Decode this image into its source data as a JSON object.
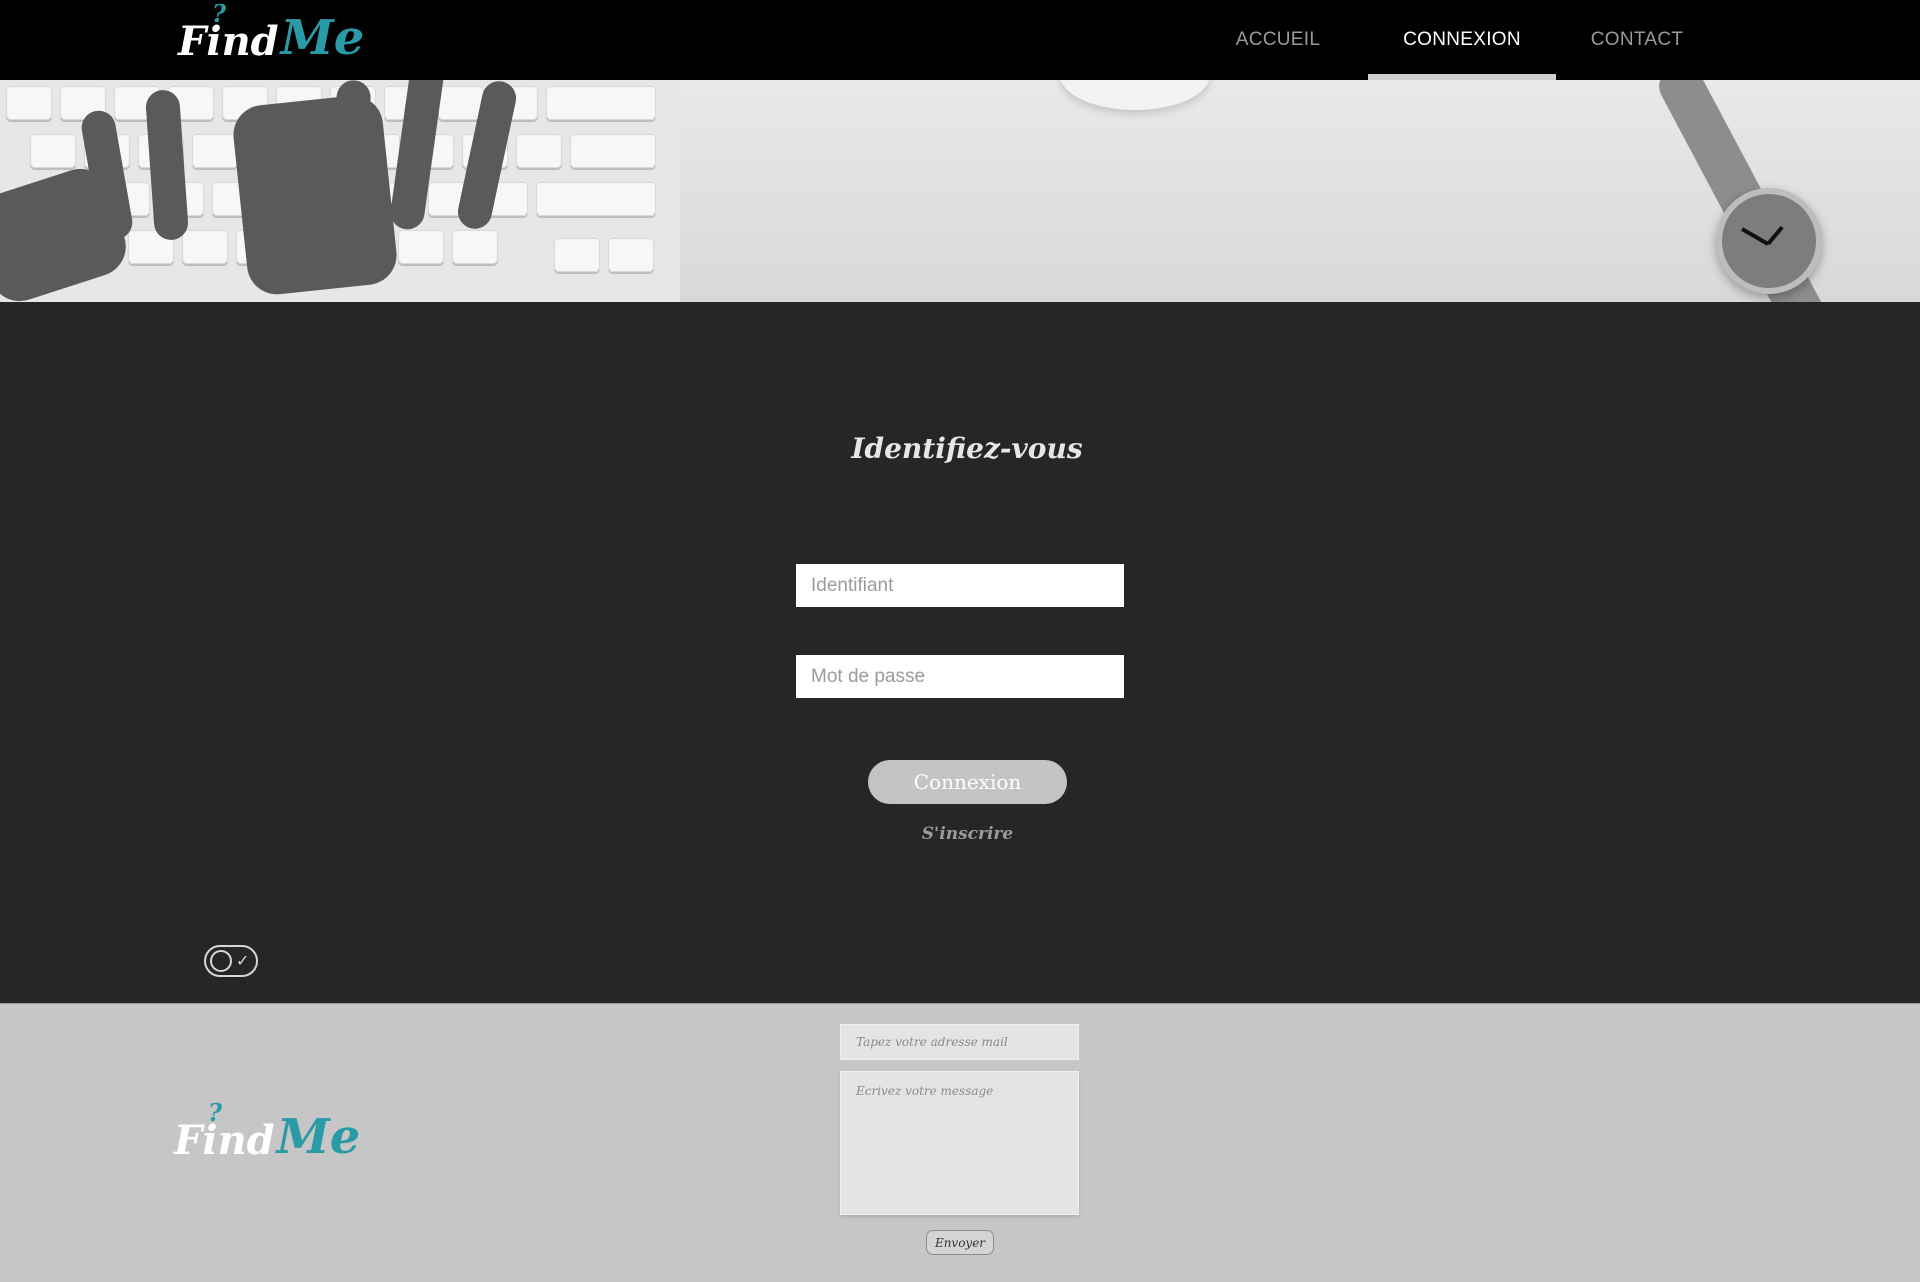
{
  "brand": {
    "find": "Find",
    "me": "Me",
    "qmark": "?"
  },
  "nav": {
    "items": [
      {
        "label": "ACCUEIL"
      },
      {
        "label": "CONNEXION",
        "active": true
      },
      {
        "label": "CONTACT"
      }
    ]
  },
  "login": {
    "title": "Identifiez-vous",
    "username_placeholder": "Identifiant",
    "password_placeholder": "Mot de passe",
    "submit_label": "Connexion",
    "signup_label": "S'inscrire"
  },
  "toggle": {
    "icon": "check-icon"
  },
  "footer": {
    "email_placeholder": "Tapez votre adresse mail",
    "message_placeholder": "Ecrivez votre message",
    "send_label": "Envoyer"
  },
  "colors": {
    "accent": "#2a9aa6",
    "header_bg": "#000000",
    "main_bg": "#262626",
    "footer_bg": "#c6c6c6",
    "button_bg": "#c4c4c4"
  }
}
